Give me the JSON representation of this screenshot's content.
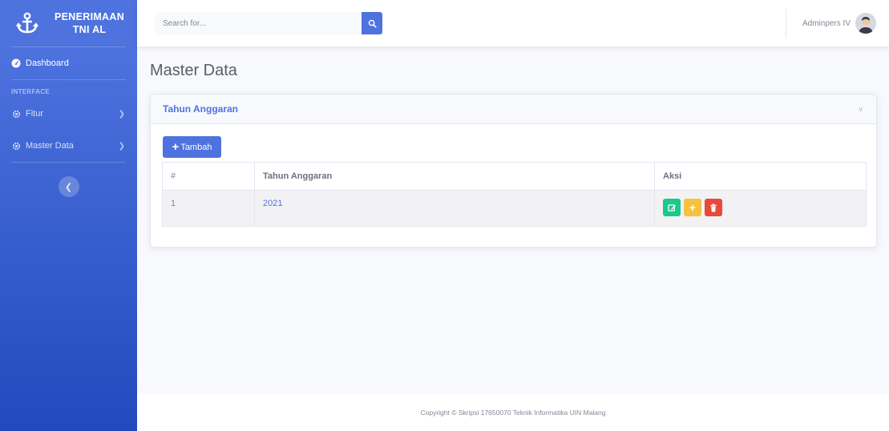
{
  "sidebar": {
    "brand_line1": "PENERIMAAN",
    "brand_line2": "TNI AL",
    "dashboard_label": "Dashboard",
    "heading": "INTERFACE",
    "items": [
      {
        "label": "Fitur",
        "icon": "cog-icon"
      },
      {
        "label": "Master Data",
        "icon": "cog-icon"
      }
    ],
    "toggle_icon": "chevron-left-icon"
  },
  "topbar": {
    "search_placeholder": "Search for...",
    "user_name": "Adminpers IV"
  },
  "main": {
    "page_title": "Master Data",
    "card_title": "Tahun Anggaran",
    "add_label": "Tambah",
    "table": {
      "headers": [
        "#",
        "Tahun Anggaran",
        "Aksi"
      ],
      "rows": [
        {
          "no": "1",
          "tahun": "2021"
        }
      ]
    }
  },
  "footer": {
    "text": "Copyright © Skripsi 17650070 Teknik Informatika UIN Malang"
  },
  "colors": {
    "primary": "#4e73df",
    "success": "#1cc88a",
    "warning": "#f6c23e",
    "danger": "#e74a3b"
  }
}
